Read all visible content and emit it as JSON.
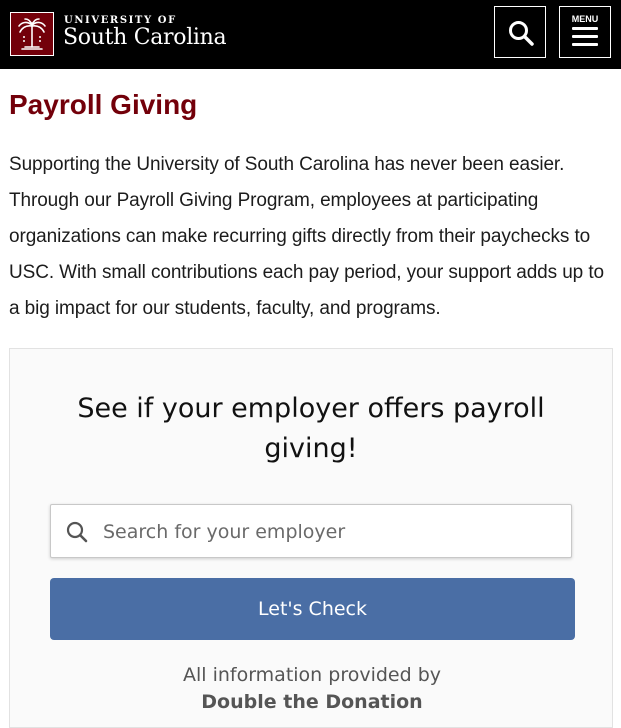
{
  "header": {
    "university_of": "UNIVERSITY OF",
    "university_name": "South Carolina",
    "menu_label": "MENU",
    "logo_icon": "palmetto-tree-icon",
    "search_icon": "search-icon",
    "menu_icon": "hamburger-menu-icon",
    "background": "#000000",
    "brand_color": "#73000a"
  },
  "main": {
    "title": "Payroll Giving",
    "intro": "Supporting the University of South Carolina has never been easier. Through our Payroll Giving Program, employees at participating organizations can make recurring gifts directly from their paychecks to USC. With small contributions each pay period, your support adds up to a big impact for our students, faculty, and programs."
  },
  "widget": {
    "heading": "See if your employer offers payroll giving!",
    "search_placeholder": "Search for your employer",
    "search_value": "",
    "button_label": "Let's Check",
    "button_color": "#4a6ea5",
    "provided_by": "All information provided by",
    "provider": "Double the Donation"
  }
}
